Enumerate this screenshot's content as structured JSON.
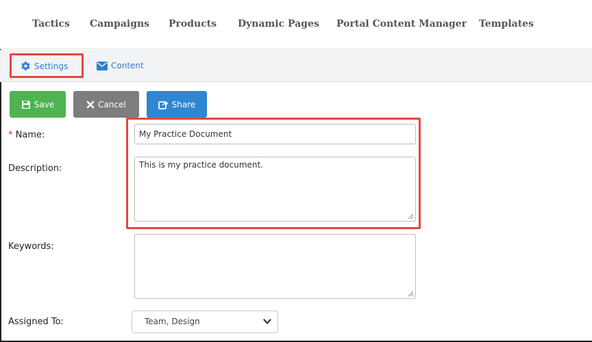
{
  "topnav": {
    "tabs": [
      "Tactics",
      "Campaigns",
      "Products",
      "Dynamic Pages",
      "Portal Content Manager",
      "Templates"
    ]
  },
  "subnav": {
    "settings": "Settings",
    "content": "Content"
  },
  "toolbar": {
    "save": "Save",
    "cancel": "Cancel",
    "share": "Share"
  },
  "form": {
    "name_required_mark": "*",
    "name_label": "Name:",
    "name_value": "My Practice Document",
    "description_label": "Description:",
    "description_value": "This is my practice document.",
    "keywords_label": "Keywords:",
    "keywords_value": "",
    "assigned_label": "Assigned To:",
    "assigned_value": "Team, Design"
  },
  "colors": {
    "highlight": "#e5463d",
    "save": "#4fb352",
    "cancel": "#7d7d7d",
    "share": "#2f86d1",
    "link": "#2f7fcf"
  },
  "icons": {
    "settings": "gear-icon",
    "content": "envelope-icon",
    "save": "floppy-disk-icon",
    "cancel": "x-icon",
    "share": "share-icon",
    "select": "chevron-down-icon"
  }
}
